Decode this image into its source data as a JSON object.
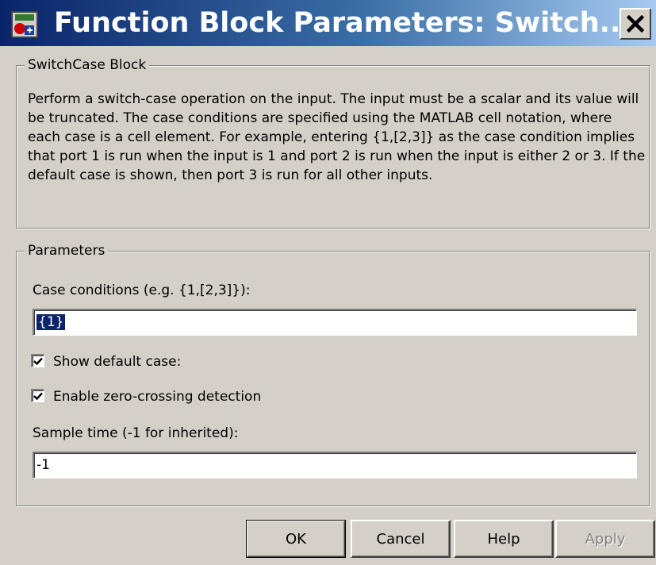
{
  "window": {
    "title": "Function Block Parameters: Switch...",
    "app_icon": "simulink-block-icon",
    "close_icon": "close-icon"
  },
  "block_group": {
    "legend": "SwitchCase Block",
    "description": "Perform a switch-case operation on the input.  The input must be a scalar and its value will be truncated.  The case conditions are specified using the MATLAB cell notation, where each case is a cell element.  For example, entering {1,[2,3]} as the case condition implies that port 1 is run when the input is 1 and port 2 is run when the input is either 2 or 3.  If the default case is shown, then port 3 is run for all other inputs."
  },
  "parameters": {
    "legend": "Parameters",
    "case_conditions": {
      "label": "Case conditions (e.g. {1,[2,3]}):",
      "value": "{1}"
    },
    "show_default": {
      "label": "Show default case:",
      "checked": true
    },
    "zero_crossing": {
      "label": "Enable zero-crossing detection",
      "checked": true
    },
    "sample_time": {
      "label": "Sample time (-1 for inherited):",
      "value": "-1"
    }
  },
  "buttons": {
    "ok": "OK",
    "cancel": "Cancel",
    "help": "Help",
    "apply": "Apply"
  },
  "colors": {
    "title_gradient_start": "#0a246a",
    "title_gradient_end": "#a6caf0",
    "dialog_face": "#d4d0c8",
    "selection": "#0a246a"
  }
}
